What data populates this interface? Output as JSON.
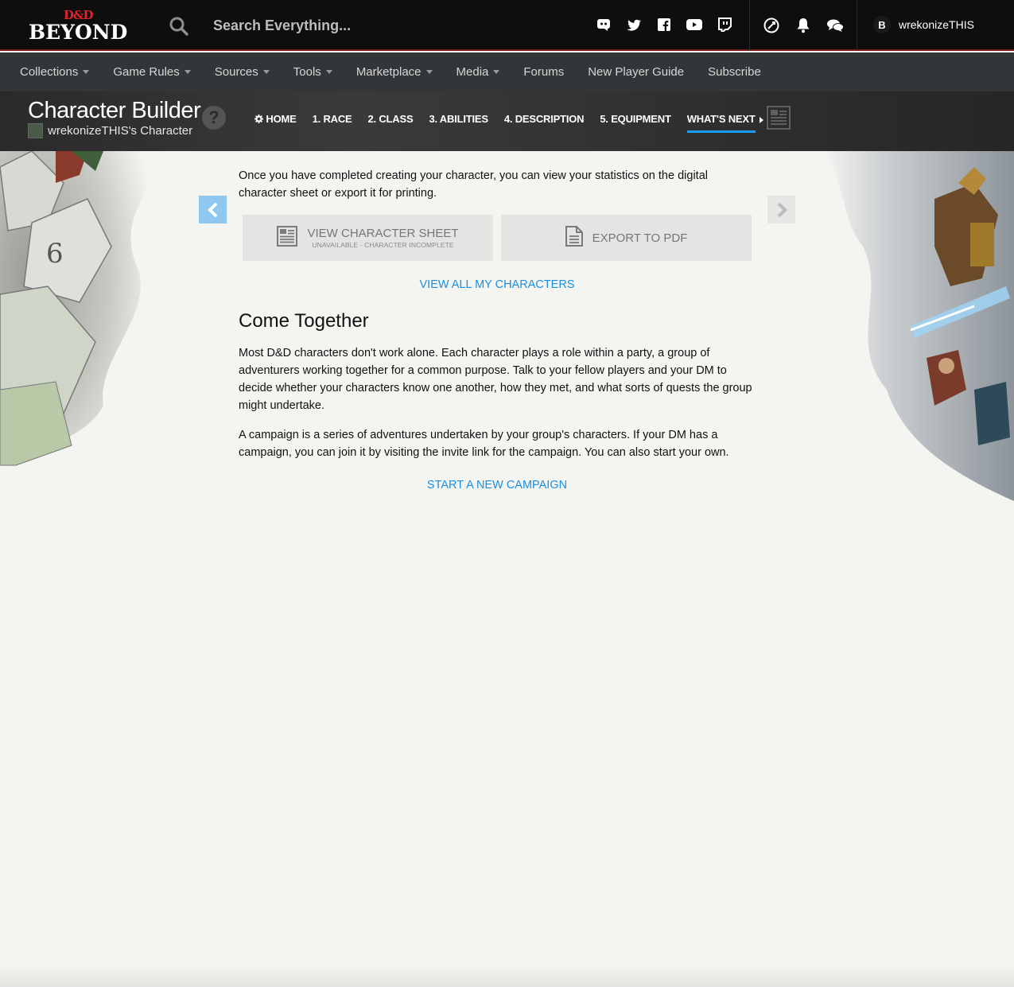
{
  "header": {
    "logo_top": "D&D",
    "logo_bottom": "BEYOND",
    "search_placeholder": "Search Everything...",
    "social_icons": [
      "discord-icon",
      "twitter-icon",
      "facebook-icon",
      "youtube-icon",
      "twitch-icon"
    ],
    "util_icons": [
      "dice-icon",
      "bell-icon",
      "chat-icon"
    ],
    "user": {
      "initial": "B",
      "name": "wrekonizeTHIS"
    }
  },
  "nav": {
    "items": [
      {
        "label": "Collections",
        "dropdown": true
      },
      {
        "label": "Game Rules",
        "dropdown": true
      },
      {
        "label": "Sources",
        "dropdown": true
      },
      {
        "label": "Tools",
        "dropdown": true
      },
      {
        "label": "Marketplace",
        "dropdown": true
      },
      {
        "label": "Media",
        "dropdown": true
      },
      {
        "label": "Forums",
        "dropdown": false
      },
      {
        "label": "New Player Guide",
        "dropdown": false
      },
      {
        "label": "Subscribe",
        "dropdown": false
      }
    ]
  },
  "builder": {
    "title": "Character Builder",
    "subtitle": "wrekonizeTHIS's Character",
    "help": "?",
    "steps": [
      {
        "label": "HOME",
        "gear": true
      },
      {
        "label": "1. RACE"
      },
      {
        "label": "2. CLASS"
      },
      {
        "label": "3. ABILITIES"
      },
      {
        "label": "4. DESCRIPTION"
      },
      {
        "label": "5. EQUIPMENT"
      },
      {
        "label": "WHAT'S NEXT",
        "active": true
      }
    ]
  },
  "main": {
    "intro": "Once you have completed creating your character, you can view your statistics on the digital character sheet or export it for printing.",
    "view_sheet": {
      "label": "VIEW CHARACTER SHEET",
      "sublabel": "UNAVAILABLE - CHARACTER INCOMPLETE"
    },
    "export_pdf": {
      "label": "EXPORT TO PDF"
    },
    "view_all_link": "VIEW ALL MY CHARACTERS",
    "section_title": "Come Together",
    "para1": "Most D&D characters don't work alone. Each character plays a role within a party, a group of adventurers working together for a common purpose. Talk to your fellow players and your DM to decide whether your characters know one another, how they met, and what sorts of quests the group might undertake.",
    "para2": "A campaign is a series of adventures undertaken by your group's characters. If your DM has a campaign, you can join it by visiting the invite link for the campaign. You can also start your own.",
    "campaign_link": "START A NEW CAMPAIGN"
  },
  "colors": {
    "accent": "#1b9af7",
    "link": "#1b8fe0",
    "header_bg": "#0e0e0e",
    "nav_bg": "#333638",
    "brand_red": "#e3222b"
  }
}
